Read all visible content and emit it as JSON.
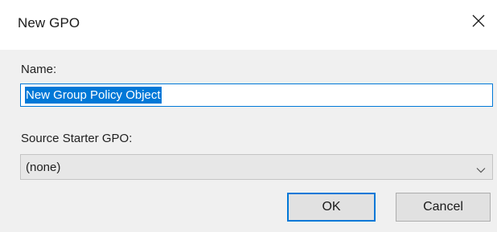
{
  "window": {
    "title": "New GPO",
    "close_icon": "close-icon"
  },
  "form": {
    "name_label": "Name:",
    "name_value": "New Group Policy Object",
    "starter_label": "Source Starter GPO:",
    "starter_selected": "(none)",
    "dropdown_icon": "chevron-down-icon"
  },
  "buttons": {
    "ok_label": "OK",
    "cancel_label": "Cancel"
  },
  "colors": {
    "accent": "#0078d7",
    "dialog_background": "#f0f0f0",
    "titlebar_background": "#ffffff",
    "button_face": "#e1e1e1"
  }
}
